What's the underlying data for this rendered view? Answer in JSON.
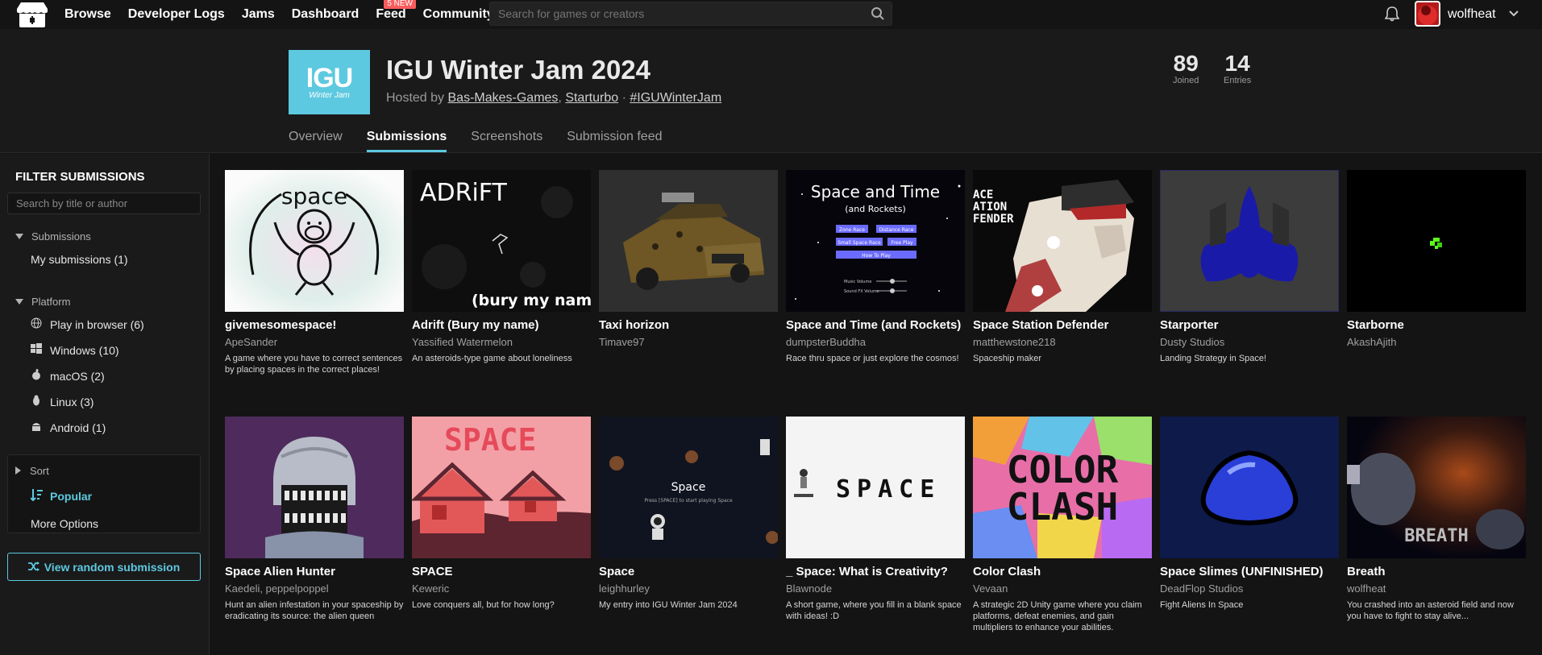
{
  "topbar": {
    "nav": [
      "Browse",
      "Developer Logs",
      "Jams",
      "Dashboard",
      "Feed",
      "Community"
    ],
    "feed_badge": "5 NEW",
    "search_placeholder": "Search for games or creators",
    "username": "wolfheat"
  },
  "jam": {
    "logo_big": "IGU",
    "logo_small": "Winter Jam",
    "title": "IGU Winter Jam 2024",
    "hosted_prefix": "Hosted by",
    "host1": "Bas-Makes-Games",
    "host2": "Starturbo",
    "hashtag": "#IGUWinterJam",
    "joined_count": "89",
    "joined_label": "Joined",
    "entries_count": "14",
    "entries_label": "Entries",
    "tabs": [
      "Overview",
      "Submissions",
      "Screenshots",
      "Submission feed"
    ],
    "active_tab": "Submissions"
  },
  "sidebar": {
    "heading": "FILTER SUBMISSIONS",
    "search_placeholder": "Search by title or author",
    "submissions_label": "Submissions",
    "my_submissions": "My submissions (1)",
    "platform_label": "Platform",
    "platforms": [
      {
        "label": "Play in browser (6)",
        "icon": "globe-icon"
      },
      {
        "label": "Windows (10)",
        "icon": "windows-icon"
      },
      {
        "label": "macOS (2)",
        "icon": "apple-icon"
      },
      {
        "label": "Linux (3)",
        "icon": "linux-icon"
      },
      {
        "label": "Android (1)",
        "icon": "android-icon"
      }
    ],
    "sort_label": "Sort",
    "sort_popular": "Popular",
    "more_options": "More Options",
    "random_button": "View random submission"
  },
  "games": [
    {
      "title": "givemesomespace!",
      "author": "ApeSander",
      "desc": "A game where you have to correct sentences by placing spaces in the correct places!",
      "thumb_text": "space"
    },
    {
      "title": "Adrift (Bury my name)",
      "author": "Yassified Watermelon",
      "desc": "An asteroids-type game about loneliness",
      "thumb_text": "ADRiFT",
      "thumb_sub": "(bury my name)"
    },
    {
      "title": "Taxi horizon",
      "author": "Timave97",
      "desc": ""
    },
    {
      "title": "Space and Time (and Rockets)",
      "author": "dumpsterBuddha",
      "desc": "Race thru space or just explore the cosmos!",
      "thumb_text": "Space and Time",
      "thumb_sub": "(and Rockets)",
      "thumb_buttons": [
        "Zone Race",
        "Distance Race",
        "Small Space Race",
        "Free Play",
        "How To Play"
      ],
      "thumb_sliders": [
        "Music Volume",
        "Sound FX Volume"
      ]
    },
    {
      "title": "Space Station Defender",
      "author": "matthewstone218",
      "desc": "Spaceship maker",
      "thumb_text": "ACE\nATION\nFENDER"
    },
    {
      "title": "Starporter",
      "author": "Dusty Studios",
      "desc": "Landing Strategy in Space!"
    },
    {
      "title": "Starborne",
      "author": "AkashAjith",
      "desc": ""
    },
    {
      "title": "Space Alien Hunter",
      "author": "Kaedeli, peppelpoppel",
      "desc": "Hunt an alien infestation in your spaceship by eradicating its source: the alien queen"
    },
    {
      "title": "SPACE",
      "author": "Keweric",
      "desc": "Love conquers all, but for how long?",
      "thumb_text": "SPACE"
    },
    {
      "title": "Space",
      "author": "leighhurley",
      "desc": "My entry into IGU Winter Jam 2024",
      "thumb_text": "Space",
      "thumb_sub": "Press [SPACE] to start playing Space"
    },
    {
      "title": "_ Space: What is Creativity?",
      "author": "Blawnode",
      "desc": "A short game, where you fill in a blank space with ideas! :D",
      "thumb_text": "SPACE"
    },
    {
      "title": "Color Clash",
      "author": "Vevaan",
      "desc": "A strategic 2D Unity game where you claim platforms, defeat enemies, and gain multipliers to enhance your abilities.",
      "thumb_text": "COLOR",
      "thumb_sub": "CLASH"
    },
    {
      "title": "Space Slimes (UNFINISHED)",
      "author": "DeadFlop Studios",
      "desc": "Fight Aliens In Space"
    },
    {
      "title": "Breath",
      "author": "wolfheat",
      "desc": "You crashed into an asteroid field and now you have to fight to stay alive...",
      "thumb_text": "BREATH"
    }
  ],
  "colors": {
    "accent": "#5dc9e0",
    "background": "#141414",
    "panel": "#1a1a1a",
    "badge": "#fa5c5c"
  }
}
